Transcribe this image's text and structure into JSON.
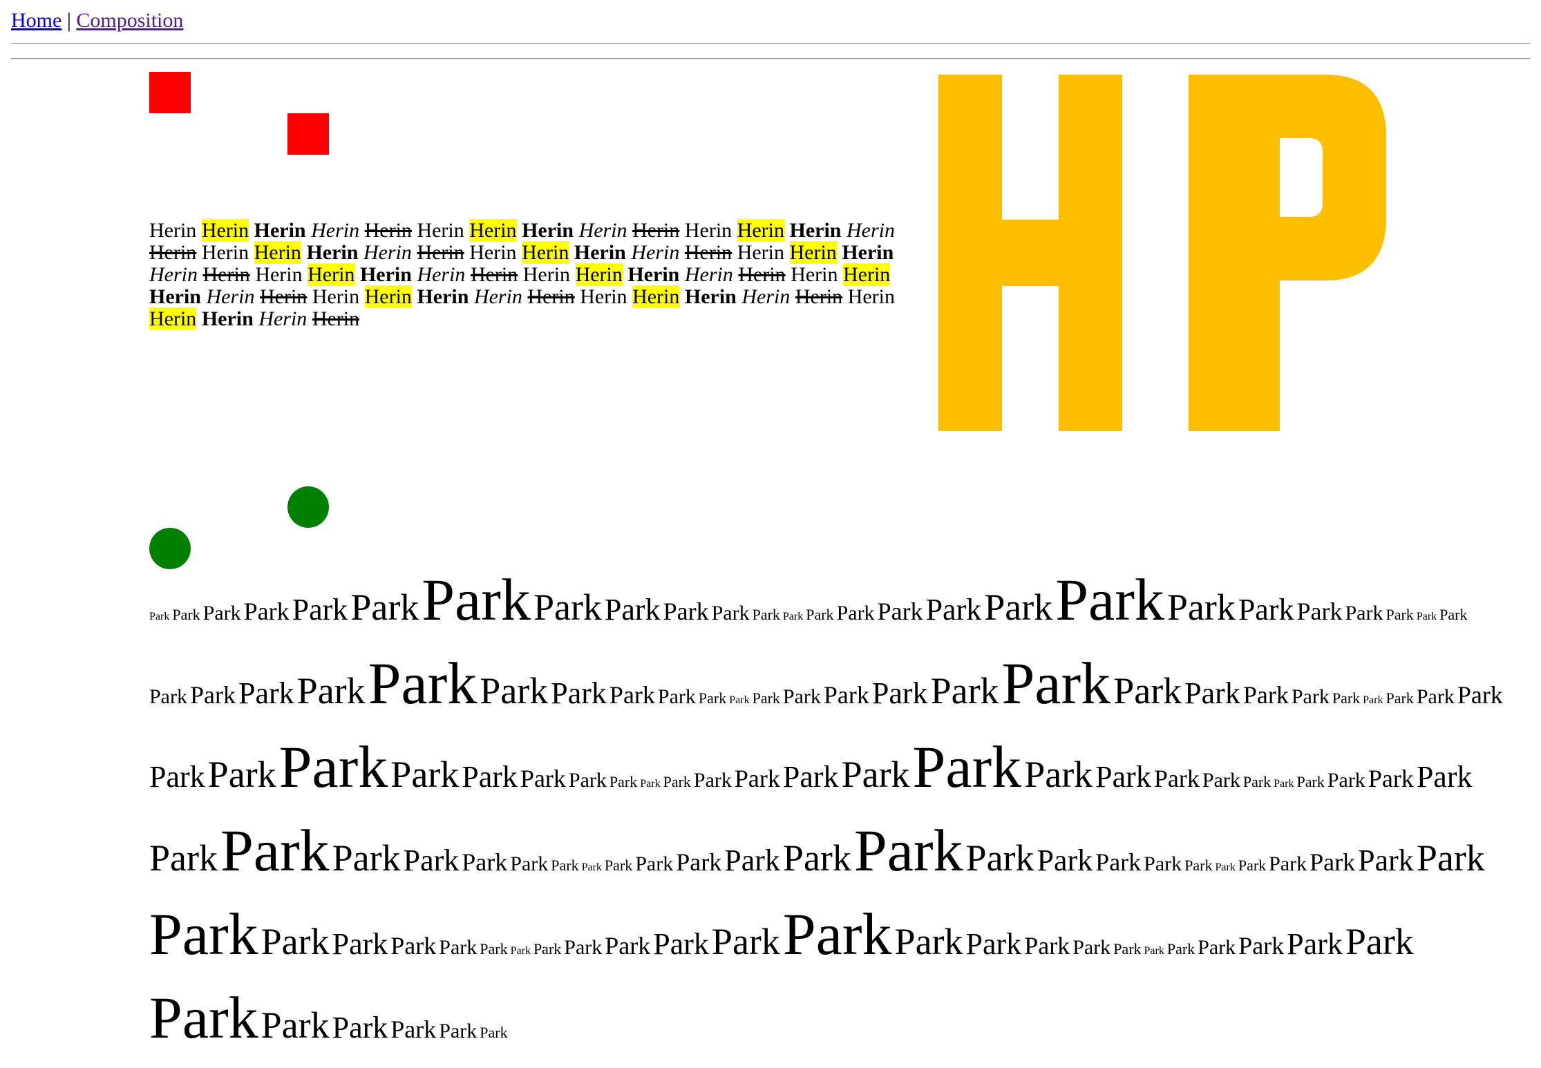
{
  "nav": {
    "home": "Home",
    "separator": "|",
    "composition": "Composition"
  },
  "colors": {
    "square": "#ff0000",
    "circle": "#008000",
    "hp_logo": "#fcbf00",
    "highlight": "#ffff00"
  },
  "herin_text": "Herin",
  "herin_count": 60,
  "herin_style_cycle": [
    "normal",
    "highlight",
    "bold",
    "italic",
    "strikethrough"
  ],
  "logo": {
    "text": "HP"
  },
  "park_text": "Park",
  "park_font_sizes_px": [
    16,
    22,
    30,
    36,
    44,
    54,
    86,
    54,
    44,
    36,
    30,
    22,
    16,
    22,
    30,
    36,
    44,
    54,
    86,
    54,
    44,
    36,
    30,
    22,
    16,
    22,
    30,
    36,
    44,
    54,
    86,
    54,
    44,
    36,
    30,
    22,
    16,
    22,
    30,
    36,
    44,
    54,
    86,
    54,
    44,
    36,
    30,
    22,
    16,
    22,
    30,
    36,
    44,
    54,
    86,
    54,
    44,
    36,
    30,
    22,
    16,
    22,
    30,
    36,
    44,
    54,
    86,
    54,
    44,
    36,
    30,
    22,
    16,
    22,
    30,
    36,
    44,
    54,
    86,
    54,
    44,
    36,
    30,
    22,
    16,
    22,
    30,
    36,
    44,
    54,
    86,
    54,
    44,
    36,
    30,
    22,
    16,
    22,
    30,
    36,
    44,
    54,
    86,
    54,
    44,
    36,
    30,
    22,
    16,
    22,
    30,
    36,
    44,
    54,
    86,
    54,
    44,
    36,
    30,
    22,
    16,
    22,
    30,
    36,
    44,
    54,
    86,
    54,
    44,
    36,
    30,
    22
  ]
}
